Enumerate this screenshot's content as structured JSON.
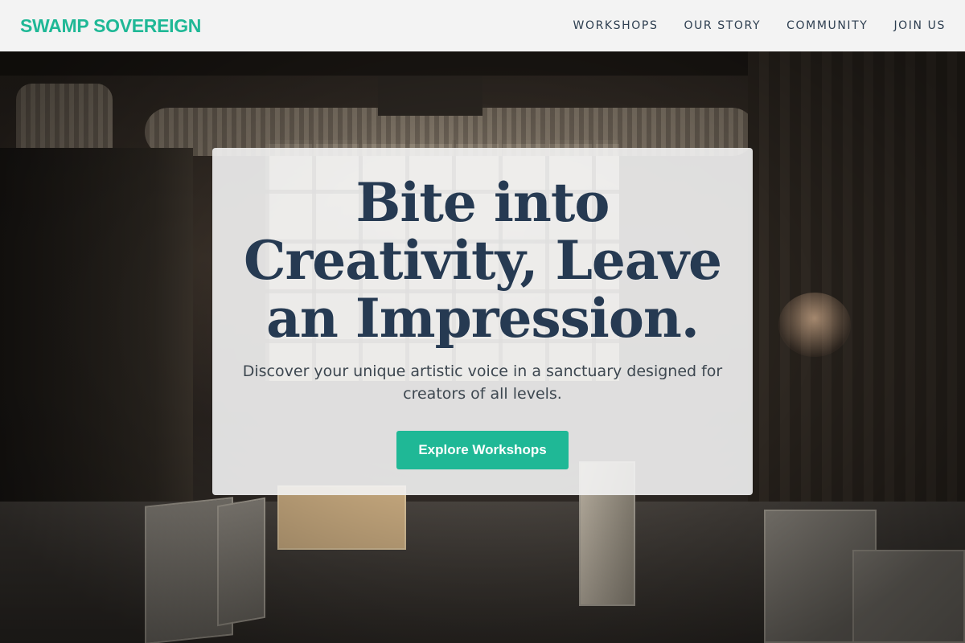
{
  "header": {
    "logo": "SWAMP SOVEREIGN",
    "nav": [
      {
        "label": "WORKSHOPS"
      },
      {
        "label": "OUR STORY"
      },
      {
        "label": "COMMUNITY"
      },
      {
        "label": "JOIN US"
      }
    ]
  },
  "hero": {
    "headline": "Bite into Creativity, Leave an Impression.",
    "subtext": "Discover your unique artistic voice in a sanctuary designed for creators of all levels.",
    "cta_label": "Explore Workshops",
    "background_image": "art-studio-warehouse-photo"
  },
  "colors": {
    "accent": "#1fb896",
    "headline": "#263a52",
    "header_bg": "#f3f3f3"
  }
}
